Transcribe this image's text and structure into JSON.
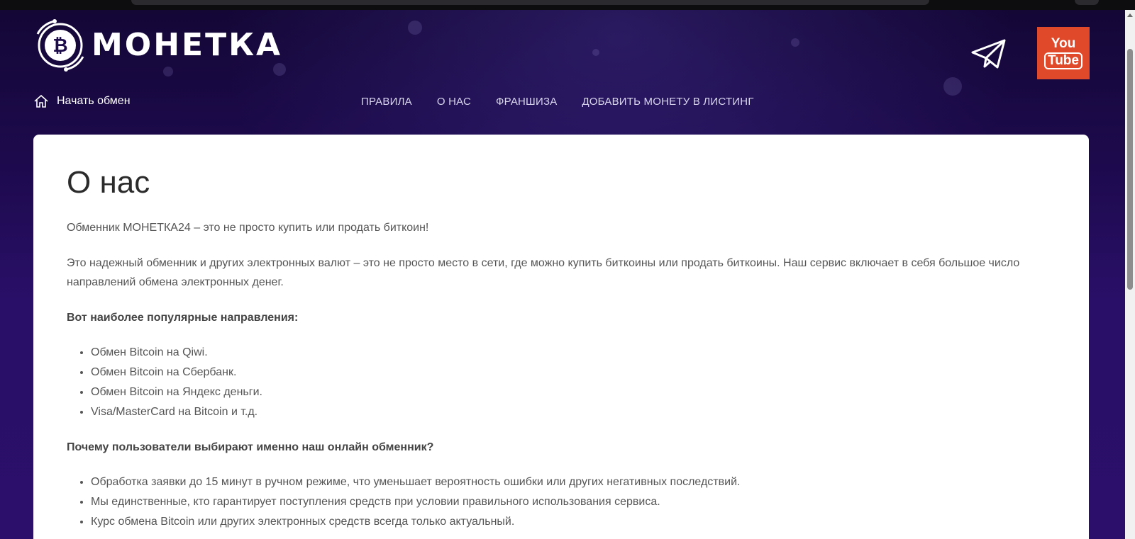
{
  "brand": {
    "logo_text": "МОНЕТКА",
    "logo_symbol": "₿"
  },
  "social": {
    "telegram_icon": "telegram-paper-plane-icon",
    "youtube": {
      "line1": "You",
      "line2": "Tube",
      "color": "#e0492a"
    }
  },
  "nav": {
    "home_label": "Начать обмен",
    "items": [
      {
        "label": "ПРАВИЛА"
      },
      {
        "label": "О НАС"
      },
      {
        "label": "ФРАНШИЗА"
      },
      {
        "label": "ДОБАВИТЬ МОНЕТУ В ЛИСТИНГ"
      }
    ]
  },
  "content": {
    "title": "О нас",
    "intro": "Обменник МОНЕТКА24 – это не просто купить или продать биткоин!",
    "paragraph": "Это надежный обменник и других электронных валют – это не просто место в сети, где можно купить биткоины или продать биткоины. Наш сервис включает в себя большое число направлений обмена электронных денег.",
    "popular_heading": "Вот наиболее популярные направления:",
    "popular_items": [
      "Обмен Bitcoin на Qiwi.",
      "Обмен Bitcoin на Сбербанк.",
      "Обмен Bitcoin на Яндекс деньги.",
      "Visa/MasterCard на Bitcoin и т.д."
    ],
    "why_heading": "Почему пользователи выбирают именно наш онлайн обменник?",
    "why_items": [
      "Обработка заявки до 15 минут в ручном режиме, что уменьшает вероятность ошибки или других негативных последствий.",
      "Мы единственные, кто гарантирует поступления средств при условии правильного использования сервиса.",
      "Курс обмена Bitcoin или других электронных средств всегда только актуальный."
    ]
  },
  "colors": {
    "background_top": "#140736",
    "background_bottom": "#2b0f6a",
    "card": "#ffffff",
    "text": "#555555"
  }
}
